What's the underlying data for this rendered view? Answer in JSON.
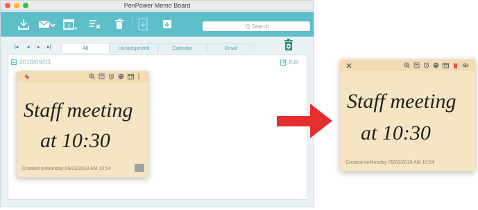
{
  "window": {
    "title": "PenPower Memo Board"
  },
  "toolbar": {
    "icons": [
      "download-icon",
      "email-icon",
      "calendar-icon",
      "filter-icon",
      "trash-icon",
      "export-icon",
      "archive-icon"
    ],
    "search_placeholder": "Q Search"
  },
  "nav": {
    "buttons": [
      "|◂",
      "◂",
      "▸",
      "▸|"
    ],
    "tabs": [
      "All",
      "Uncategorized",
      "Calendar",
      "Email"
    ]
  },
  "board": {
    "date": "2018/09/03",
    "edit_label": "Edit"
  },
  "memo1": {
    "handwriting_line1": "Staff meeting",
    "handwriting_line2": "at 10:30",
    "created": "Created onMonday 09/03/2018 AM 10:54"
  },
  "memo2": {
    "handwriting_line1": "Staff meeting",
    "handwriting_line2": "at 10:30",
    "created": "Created onMonday 09/03/2018 AM 10:54"
  },
  "colors": {
    "toolbar": "#5ebfcb",
    "memo": "#f6e5c3",
    "memo_header": "#f1dcb4",
    "arrow": "#e52d2d",
    "pin": "#e3534a",
    "trash_red": "#e3534a"
  }
}
